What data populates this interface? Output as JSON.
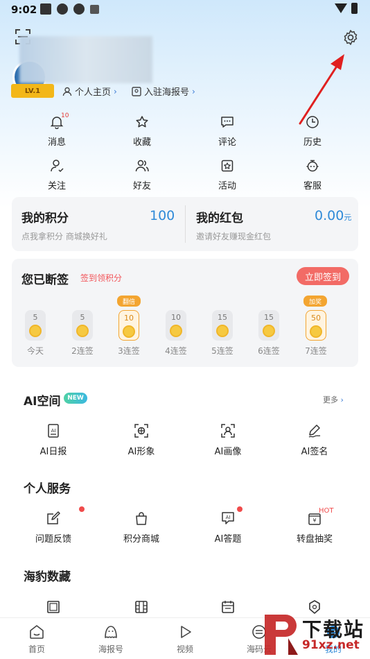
{
  "status": {
    "time": "9:02"
  },
  "profile": {
    "level": "LV.1",
    "home_link": "个人主页",
    "join_link": "入驻海报号"
  },
  "quick_actions": [
    {
      "label": "消息",
      "icon": "bell-icon",
      "badge": "10"
    },
    {
      "label": "收藏",
      "icon": "star-icon"
    },
    {
      "label": "评论",
      "icon": "comment-icon"
    },
    {
      "label": "历史",
      "icon": "clock-icon"
    },
    {
      "label": "关注",
      "icon": "follow-icon"
    },
    {
      "label": "好友",
      "icon": "friends-icon"
    },
    {
      "label": "活动",
      "icon": "activity-icon"
    },
    {
      "label": "客服",
      "icon": "service-icon"
    }
  ],
  "points": {
    "title": "我的积分",
    "value": "100",
    "subtitle": "点我拿积分 商城换好礼"
  },
  "red_packet": {
    "title": "我的红包",
    "value": "0.00",
    "unit": "元",
    "subtitle": "邀请好友赚现金红包"
  },
  "checkin": {
    "title": "您已断签",
    "hint": "签到领积分",
    "button": "立即签到",
    "days": [
      {
        "points": "5",
        "label": "今天"
      },
      {
        "points": "5",
        "label": "2连签"
      },
      {
        "points": "10",
        "label": "3连签",
        "tag": "翻倍"
      },
      {
        "points": "10",
        "label": "4连签"
      },
      {
        "points": "15",
        "label": "5连签"
      },
      {
        "points": "15",
        "label": "6连签"
      },
      {
        "points": "50",
        "label": "7连签",
        "tag": "加奖"
      }
    ]
  },
  "ai_space": {
    "title": "AI空间",
    "badge": "NEW",
    "more": "更多",
    "items": [
      {
        "label": "AI日报",
        "icon": "ai-daily-icon"
      },
      {
        "label": "AI形象",
        "icon": "ai-avatar-icon"
      },
      {
        "label": "AI画像",
        "icon": "ai-portrait-icon"
      },
      {
        "label": "AI签名",
        "icon": "ai-signature-icon"
      }
    ]
  },
  "personal_service": {
    "title": "个人服务",
    "items": [
      {
        "label": "问题反馈",
        "icon": "feedback-icon",
        "dot": true
      },
      {
        "label": "积分商城",
        "icon": "shop-bag-icon"
      },
      {
        "label": "AI答题",
        "icon": "ai-quiz-icon",
        "dot": true
      },
      {
        "label": "转盘抽奖",
        "icon": "lottery-icon",
        "hot": "HOT"
      }
    ]
  },
  "collection": {
    "title": "海豹数藏"
  },
  "bottom_nav": [
    {
      "label": "首页",
      "icon": "home-icon"
    },
    {
      "label": "海报号",
      "icon": "seal-icon"
    },
    {
      "label": "视频",
      "icon": "play-icon"
    },
    {
      "label": "海码云",
      "icon": "cloud-icon"
    },
    {
      "label": "我的",
      "icon": "mine-icon"
    }
  ],
  "watermark": {
    "title": "下载站",
    "url": "91xz.net"
  },
  "colors": {
    "accent_blue": "#2f8ad8",
    "sign_red": "#f26b66",
    "gold": "#f3a531",
    "arrow_red": "#e02020"
  }
}
